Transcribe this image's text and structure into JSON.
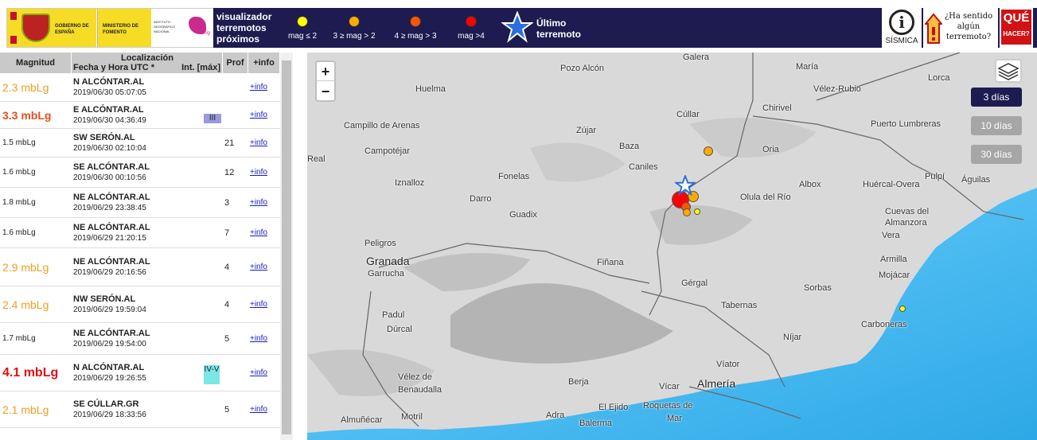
{
  "header": {
    "logos": {
      "gobierno": "GOBIERNO DE ESPAÑA",
      "ministerio": "MINISTERIO DE FOMENTO",
      "instituto": "INSTITUTO GEOGRÁFICO NACIONAL",
      "cnig": "cnig"
    },
    "title_line1": "visualizador",
    "title_line2": "terremotos",
    "title_line3": "próximos",
    "legend": [
      {
        "label": "mag ≤ 2",
        "color": "#ffff00"
      },
      {
        "label": "3 ≥ mag > 2",
        "color": "#ffaa00"
      },
      {
        "label": "4 ≥ mag > 3",
        "color": "#ff5500"
      },
      {
        "label": "mag >4",
        "color": "#ff0000"
      }
    ],
    "ultimo_line1": "Último",
    "ultimo_line2": "terremoto",
    "sismica_label": "SÍSMICA",
    "sentido_text": "¿Ha sentido algún terremoto?",
    "que": "QUÉ",
    "hacer": "HACER?"
  },
  "list": {
    "headers": {
      "magnitud": "Magnitud",
      "localizacion": "Localización",
      "fecha": "Fecha y Hora UTC *",
      "intensidad": "Int. [máx]",
      "prof": "Prof",
      "info": "+info"
    },
    "rows": [
      {
        "mag": "2.3 mbLg",
        "color": "#f0a020",
        "size": 14,
        "bold": false,
        "place": "N ALCÓNTAR.AL",
        "date": "2019/06/30 05:07:05",
        "int": "",
        "int_color": "",
        "prof": "",
        "info": "+info"
      },
      {
        "mag": "3.3 mbLg",
        "color": "#e4501e",
        "size": 14,
        "bold": true,
        "place": "E ALCÓNTAR.AL",
        "date": "2019/06/30 04:36:49",
        "int": "III",
        "int_color": "#9a9adc",
        "prof": "",
        "info": "+info"
      },
      {
        "mag": "1.5 mbLg",
        "color": "#222222",
        "size": 10,
        "bold": false,
        "place": "SW SERÓN.AL",
        "date": "2019/06/30 02:10:04",
        "int": "",
        "int_color": "",
        "prof": "21",
        "info": "+info"
      },
      {
        "mag": "1.6 mbLg",
        "color": "#222222",
        "size": 10,
        "bold": false,
        "place": "SE ALCÓNTAR.AL",
        "date": "2019/06/30 00:10:56",
        "int": "",
        "int_color": "",
        "prof": "12",
        "info": "+info"
      },
      {
        "mag": "1.8 mbLg",
        "color": "#222222",
        "size": 10,
        "bold": false,
        "place": "NE ALCÓNTAR.AL",
        "date": "2019/06/29 23:38:45",
        "int": "",
        "int_color": "",
        "prof": "3",
        "info": "+info"
      },
      {
        "mag": "1.6 mbLg",
        "color": "#222222",
        "size": 10,
        "bold": false,
        "place": "NE ALCÓNTAR.AL",
        "date": "2019/06/29 21:20:15",
        "int": "",
        "int_color": "",
        "prof": "7",
        "info": "+info"
      },
      {
        "mag": "2.9 mbLg",
        "color": "#f0a020",
        "size": 14,
        "bold": false,
        "place": "NE ALCÓNTAR.AL",
        "date": "2019/06/29 20:16:56",
        "int": "",
        "int_color": "",
        "prof": "4",
        "info": "+info"
      },
      {
        "mag": "2.4 mbLg",
        "color": "#f0a020",
        "size": 14,
        "bold": false,
        "place": "NW SERÓN.AL",
        "date": "2019/06/29 19:59:04",
        "int": "",
        "int_color": "",
        "prof": "4",
        "info": "+info"
      },
      {
        "mag": "1.7 mbLg",
        "color": "#222222",
        "size": 10,
        "bold": false,
        "place": "NE ALCÓNTAR.AL",
        "date": "2019/06/29 19:54:00",
        "int": "",
        "int_color": "",
        "prof": "5",
        "info": "+info"
      },
      {
        "mag": "4.1 mbLg",
        "color": "#e01010",
        "size": 16,
        "bold": true,
        "place": "N ALCÓNTAR.AL",
        "date": "2019/06/29 19:26:55",
        "int": "IV-V",
        "int_color": "#7ae6e6",
        "prof": "",
        "info": "+info"
      },
      {
        "mag": "2.1 mbLg",
        "color": "#f0a020",
        "size": 14,
        "bold": false,
        "place": "SE CÚLLAR.GR",
        "date": "2019/06/29 18:33:56",
        "int": "",
        "int_color": "",
        "prof": "5",
        "info": "+info"
      }
    ]
  },
  "map": {
    "zoom_in": "+",
    "zoom_out": "−",
    "days_3": "3 días",
    "days_10": "10 días",
    "days_30": "30 días",
    "towns": [
      "Galera",
      "Pozo Alcón",
      "María",
      "Huelma",
      "Vélez-Rubio",
      "Lorca",
      "Chirivel",
      "Cúllar",
      "Campillo de Arenas",
      "Puerto Lumbreras",
      "Zújar",
      "Campotéjar",
      "Baza",
      "Oria",
      "Real",
      "Caniles",
      "Pulpí",
      "Fonelas",
      "Águilas",
      "Iznalloz",
      "Albox",
      "Huércal-Overa",
      "Olula del Río",
      "Darro",
      "Cuevas del",
      "Almanzora",
      "Guadix",
      "Vera",
      "Peligros",
      "Granada",
      "Fiñana",
      "Garrucha",
      "Armilla",
      "Mojácar",
      "Gérgal",
      "Sorbas",
      "Tabernas",
      "Padul",
      "Carboneras",
      "Dúrcal",
      "Níjar",
      "Víator",
      "Vélez de",
      "Benaudalla",
      "Berja",
      "Almería",
      "Vícar",
      "El Ejido",
      "Roquetas de",
      "Mar",
      "Motril",
      "Adra",
      "Almuñécar",
      "Balerma"
    ]
  }
}
